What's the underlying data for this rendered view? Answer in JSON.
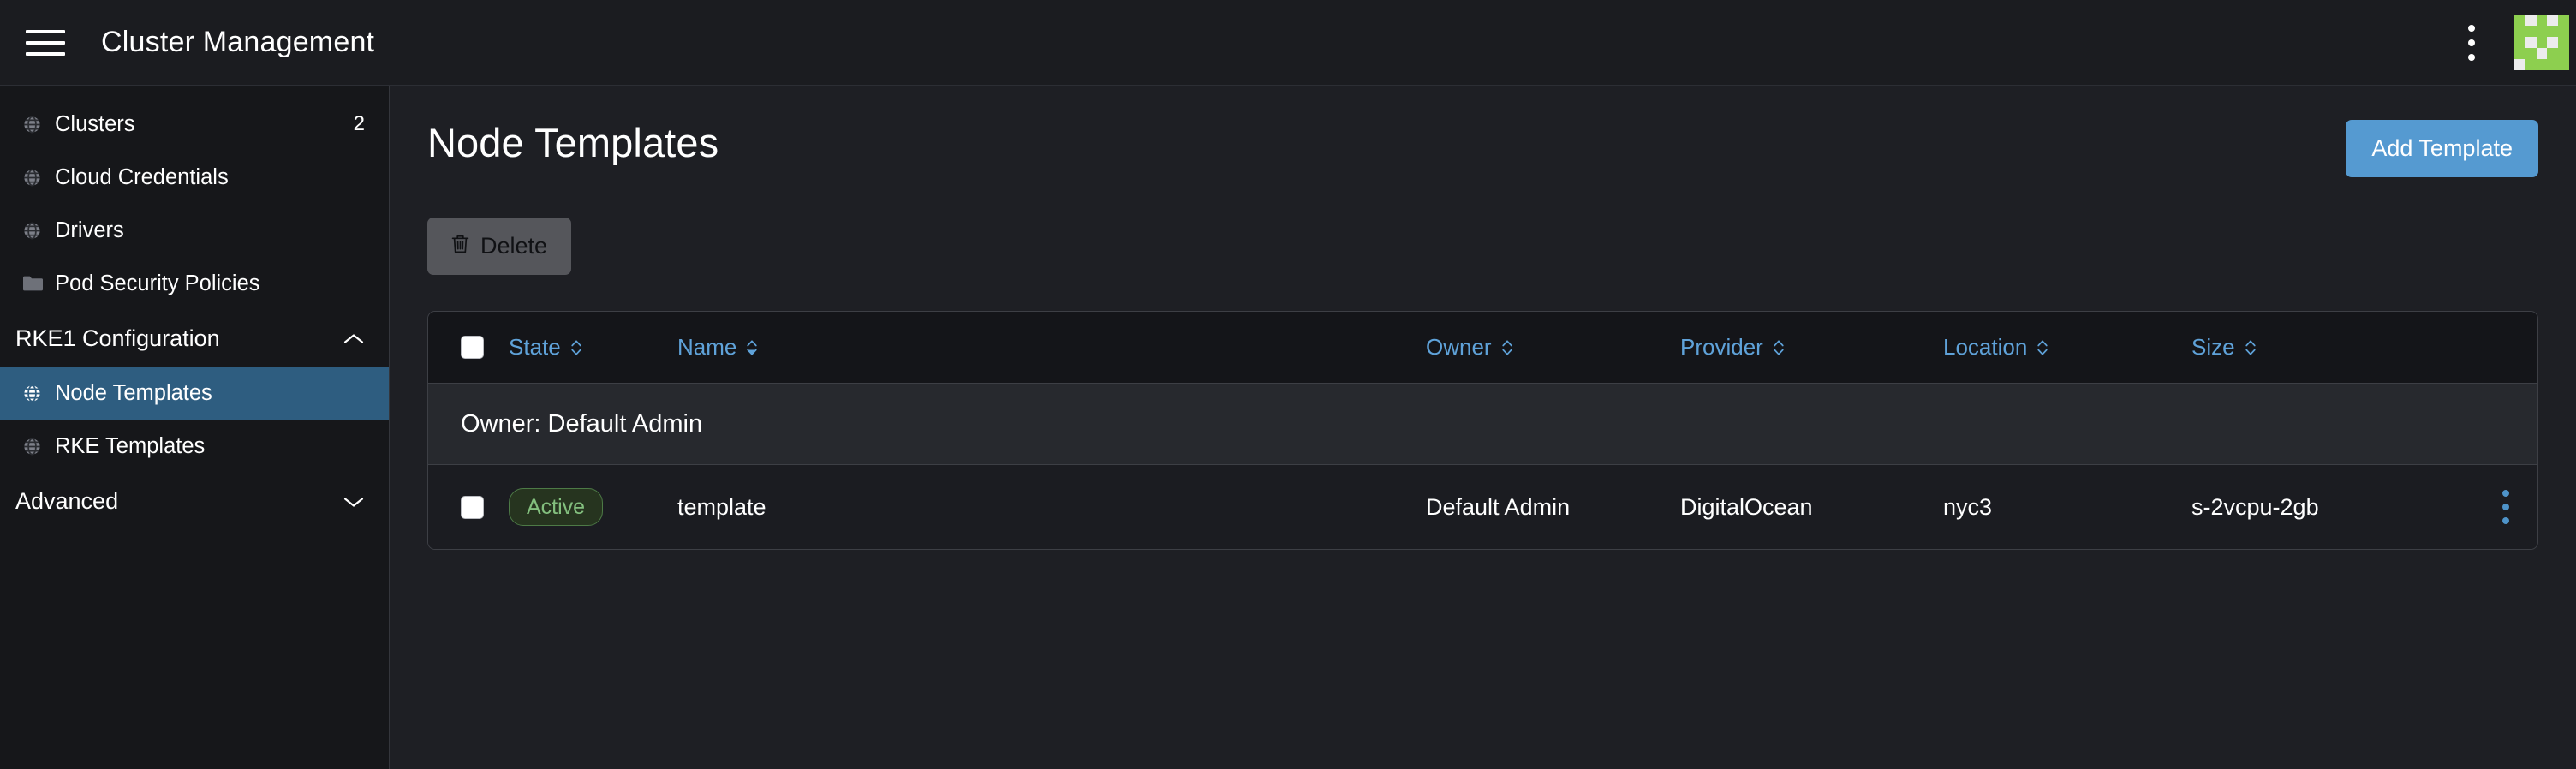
{
  "header": {
    "title": "Cluster Management",
    "menu_icon": "hamburger-icon",
    "overflow_icon": "kebab-menu-icon",
    "avatar_icon": "user-avatar-identicon",
    "avatar_color": "#8dcf4f"
  },
  "sidebar": {
    "items": [
      {
        "label": "Clusters",
        "icon": "globe-icon",
        "count": "2",
        "active": false,
        "type": "link"
      },
      {
        "label": "Cloud Credentials",
        "icon": "globe-icon",
        "count": "",
        "active": false,
        "type": "link"
      },
      {
        "label": "Drivers",
        "icon": "globe-icon",
        "count": "",
        "active": false,
        "type": "link"
      },
      {
        "label": "Pod Security Policies",
        "icon": "folder-icon",
        "count": "",
        "active": false,
        "type": "link"
      }
    ],
    "group_rke1": {
      "label": "RKE1 Configuration",
      "chevron": "chevron-up-icon",
      "expanded": true
    },
    "rke1_items": [
      {
        "label": "Node Templates",
        "icon": "globe-icon",
        "count": "",
        "active": true,
        "type": "link"
      },
      {
        "label": "RKE Templates",
        "icon": "globe-icon",
        "count": "",
        "active": false,
        "type": "link"
      }
    ],
    "group_advanced": {
      "label": "Advanced",
      "chevron": "chevron-down-icon",
      "expanded": false
    },
    "active_color": "#2e5d80"
  },
  "main": {
    "page_title": "Node Templates",
    "add_button": "Add Template",
    "add_button_color": "#559ad1",
    "delete_button": "Delete",
    "delete_icon": "trash-icon",
    "table": {
      "columns": [
        {
          "label": "State",
          "sortable": true,
          "sorted": false
        },
        {
          "label": "Name",
          "sortable": true,
          "sorted": true
        },
        {
          "label": "Owner",
          "sortable": true,
          "sorted": false
        },
        {
          "label": "Provider",
          "sortable": true,
          "sorted": false
        },
        {
          "label": "Location",
          "sortable": true,
          "sorted": false
        },
        {
          "label": "Size",
          "sortable": true,
          "sorted": false
        }
      ],
      "group_label": "Owner: Default Admin",
      "rows": [
        {
          "state": "Active",
          "state_color": "#83bf7e",
          "name": "template",
          "owner": "Default Admin",
          "provider": "DigitalOcean",
          "location": "nyc3",
          "size": "s-2vcpu-2gb",
          "menu_icon": "kebab-menu-icon"
        }
      ]
    }
  }
}
